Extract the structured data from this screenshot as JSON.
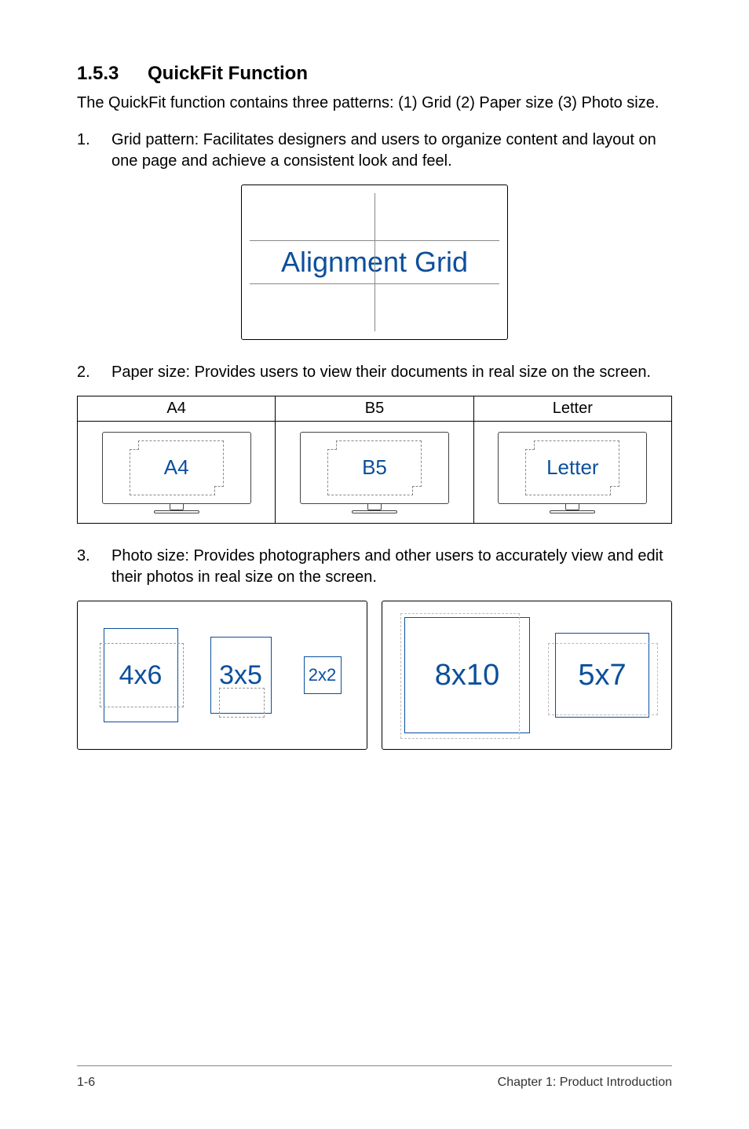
{
  "heading": {
    "number": "1.5.3",
    "title": "QuickFit Function"
  },
  "intro": "The QuickFit function contains three patterns: (1) Grid (2) Paper size (3) Photo size.",
  "items": [
    {
      "n": "1.",
      "t": "Grid pattern: Facilitates designers and users to organize content and layout on one page and achieve a consistent look and feel."
    },
    {
      "n": "2.",
      "t": "Paper size: Provides users to view their documents in real size on the screen."
    },
    {
      "n": "3.",
      "t": "Photo size: Provides photographers and other users to accurately view and edit their photos in real size on the screen."
    }
  ],
  "grid_label": "Alignment Grid",
  "paper": {
    "headers": [
      "A4",
      "B5",
      "Letter"
    ],
    "labels": [
      "A4",
      "B5",
      "Letter"
    ]
  },
  "photo": {
    "labels": [
      "4x6",
      "3x5",
      "2x2",
      "8x10",
      "5x7"
    ]
  },
  "footer": {
    "left": "1-6",
    "right": "Chapter 1: Product Introduction"
  }
}
